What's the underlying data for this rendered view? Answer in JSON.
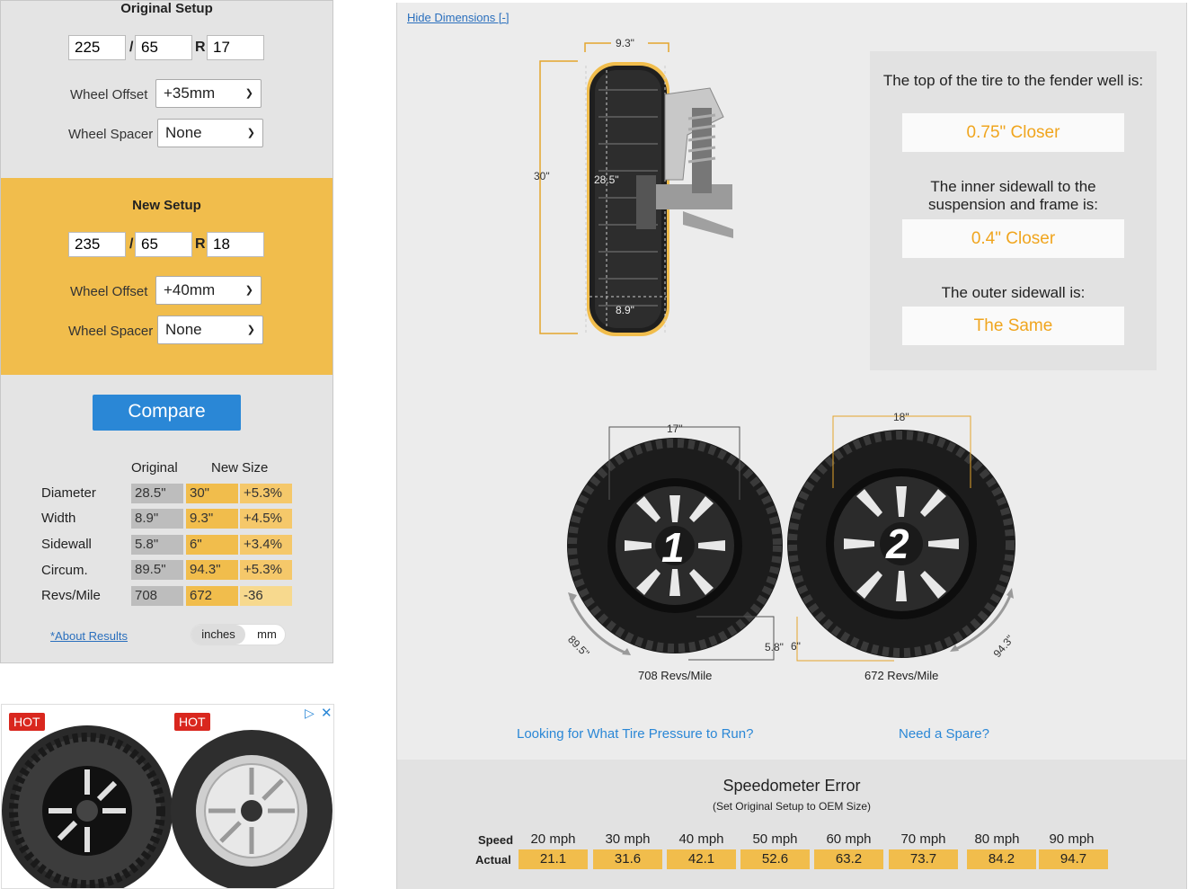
{
  "original": {
    "title": "Original Setup",
    "width": "225",
    "ratio": "65",
    "rim": "17",
    "sep_slash": "/",
    "sep_r": "R",
    "offset_label": "Wheel Offset",
    "offset": "+35mm",
    "spacer_label": "Wheel Spacer",
    "spacer": "None"
  },
  "newsetup": {
    "title": "New Setup",
    "width": "235",
    "ratio": "65",
    "rim": "18",
    "offset_label": "Wheel Offset",
    "offset": "+40mm",
    "spacer_label": "Wheel Spacer",
    "spacer": "None"
  },
  "compare_label": "Compare",
  "results": {
    "col_original": "Original",
    "col_new": "New Size",
    "rows": [
      {
        "label": "Diameter",
        "orig": "28.5\"",
        "new": "30\"",
        "diff": "+5.3%"
      },
      {
        "label": "Width",
        "orig": "8.9\"",
        "new": "9.3\"",
        "diff": "+4.5%"
      },
      {
        "label": "Sidewall",
        "orig": "5.8\"",
        "new": "6\"",
        "diff": "+3.4%"
      },
      {
        "label": "Circum.",
        "orig": "89.5\"",
        "new": "94.3\"",
        "diff": "+5.3%"
      },
      {
        "label": "Revs/Mile",
        "orig": "708",
        "new": "672",
        "diff": "-36"
      }
    ],
    "about_link": "*About Results",
    "unit_inches": "inches",
    "unit_mm": "mm"
  },
  "ad": {
    "hot1": "HOT",
    "hot2": "HOT"
  },
  "diagram": {
    "hide_link": "Hide Dimensions [-]",
    "width_new": "9.3\"",
    "height_new": "30\"",
    "height_orig": "28.5\"",
    "width_orig": "8.9\""
  },
  "fitment": {
    "q1": "The top of the tire to the fender well is:",
    "a1": "0.75\" Closer",
    "q2": "The inner sidewall to the suspension and frame is:",
    "a2": "0.4\" Closer",
    "q3": "The outer sidewall is:",
    "a3": "The Same"
  },
  "wheels": {
    "w1_rim": "17\"",
    "w1_num": "1",
    "w1_circ": "89.5\"",
    "w1_sidewall": "5.8\"",
    "w1_revs": "708 Revs/Mile",
    "w2_rim": "18\"",
    "w2_num": "2",
    "w2_circ": "94.3\"",
    "w2_sidewall": "6\"",
    "w2_revs": "672 Revs/Mile"
  },
  "links": {
    "pressure": "Looking for What Tire Pressure to Run?",
    "spare": "Need a Spare?"
  },
  "speedometer": {
    "title": "Speedometer Error",
    "subtitle": "(Set Original Setup to OEM Size)",
    "speed_label": "Speed",
    "actual_label": "Actual",
    "speeds": [
      "20 mph",
      "30 mph",
      "40 mph",
      "50 mph",
      "60 mph",
      "70 mph",
      "80 mph",
      "90 mph"
    ],
    "actuals": [
      "21.1",
      "31.6",
      "42.1",
      "52.6",
      "63.2",
      "73.7",
      "84.2",
      "94.7"
    ]
  },
  "colors": {
    "accent": "#f1bd4c",
    "button": "#2a87d6",
    "answer": "#f0a51e"
  }
}
